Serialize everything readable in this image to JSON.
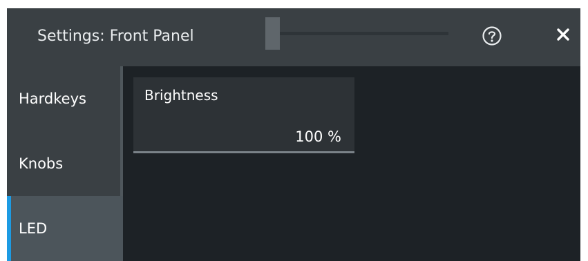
{
  "dialog": {
    "title": "Settings: Front Panel",
    "help_icon": "help-circle-icon",
    "close_icon": "close-icon"
  },
  "sidebar": {
    "items": [
      {
        "label": "Hardkeys",
        "selected": false
      },
      {
        "label": "Knobs",
        "selected": false
      },
      {
        "label": "LED",
        "selected": true
      }
    ]
  },
  "brightness": {
    "label": "Brightness",
    "value": "100 %"
  },
  "colors": {
    "accent": "#1d9be3",
    "titlebar": "#3a4044",
    "background": "#1d2226"
  }
}
